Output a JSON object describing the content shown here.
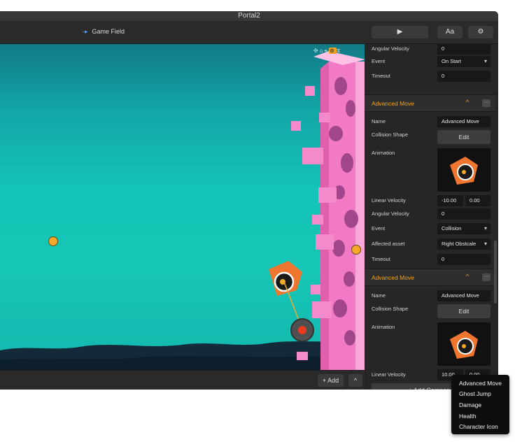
{
  "window": {
    "title": "Portal2"
  },
  "toolbar": {
    "breadcrumb": "Game Field",
    "play_icon": "play-icon",
    "font_button": "Aa",
    "settings_icon": "gear-icon"
  },
  "canvas_tools": [
    "move-icon",
    "lock-icon",
    "anchor-icon",
    "link-icon",
    "layers-icon"
  ],
  "bottom_bar": {
    "add_button": "+ Add",
    "collapse_icon": "chevron-up-icon"
  },
  "inspector": {
    "top": [
      {
        "label": "Angular Velocity",
        "value": "0"
      },
      {
        "label": "Event",
        "value": "On Start"
      },
      {
        "label": "Timeout",
        "value": "0"
      }
    ],
    "sections": [
      {
        "title": "Advanced Move",
        "name_label": "Name",
        "name_value": "Advanced Move",
        "collision_label": "Collision Shape",
        "edit_label": "Edit",
        "animation_label": "Animation",
        "linear_label": "Linear Velocity",
        "linear_x": "-10.00",
        "linear_y": "0.00",
        "angular_label": "Angular Velocity",
        "angular_value": "0",
        "event_label": "Event",
        "event_value": "Collision",
        "asset_label": "Affected asset",
        "asset_value": "Right Obstcale",
        "timeout_label": "Timeout",
        "timeout_value": "0"
      },
      {
        "title": "Advanced Move",
        "name_label": "Name",
        "name_value": "Advanced Move",
        "collision_label": "Collision Shape",
        "edit_label": "Edit",
        "animation_label": "Animation",
        "linear_label": "Linear Velocity",
        "linear_x": "10.00",
        "linear_y": "0.00"
      }
    ],
    "add_component": "+ Add Compone"
  },
  "popup_menu": [
    "Advanced Move",
    "Ghost Jump",
    "Damage",
    "Health",
    "Character Icon"
  ],
  "colors": {
    "accent": "#f1a31d",
    "sky_top": "#127a86",
    "sky_mid": "#16c6b6",
    "tower_pink": "#f27ac4"
  }
}
